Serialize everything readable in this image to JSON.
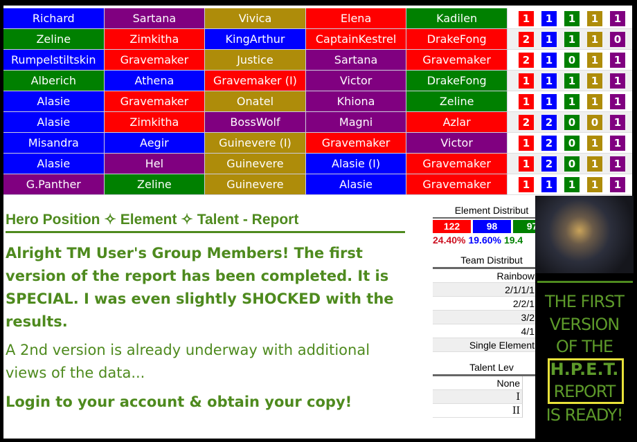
{
  "colors": {
    "red": "#ff0000",
    "blue": "#0000ff",
    "green": "#008000",
    "gold": "#ae8c0a",
    "purple": "#800080",
    "accent": "#4e8a1e"
  },
  "teams": [
    {
      "heroes": [
        [
          "Richard",
          "blue"
        ],
        [
          "Sartana",
          "purple"
        ],
        [
          "Vivica",
          "gold"
        ],
        [
          "Elena",
          "red"
        ],
        [
          "Kadilen",
          "green"
        ]
      ],
      "counts": [
        1,
        1,
        1,
        1,
        1
      ]
    },
    {
      "heroes": [
        [
          "Zeline",
          "green"
        ],
        [
          "Zimkitha",
          "red"
        ],
        [
          "KingArthur",
          "blue"
        ],
        [
          "CaptainKestrel",
          "red"
        ],
        [
          "DrakeFong",
          "red"
        ]
      ],
      "counts": [
        2,
        1,
        1,
        1,
        0
      ]
    },
    {
      "heroes": [
        [
          "Rumpelstiltskin",
          "blue"
        ],
        [
          "Gravemaker",
          "red"
        ],
        [
          "Justice",
          "gold"
        ],
        [
          "Sartana",
          "purple"
        ],
        [
          "Gravemaker",
          "red"
        ]
      ],
      "counts": [
        2,
        1,
        0,
        1,
        1
      ]
    },
    {
      "heroes": [
        [
          "Alberich",
          "green"
        ],
        [
          "Athena",
          "blue"
        ],
        [
          "Gravemaker (I)",
          "red"
        ],
        [
          "Victor",
          "purple"
        ],
        [
          "DrakeFong",
          "green"
        ]
      ],
      "counts": [
        1,
        1,
        1,
        1,
        1
      ]
    },
    {
      "heroes": [
        [
          "Alasie",
          "blue"
        ],
        [
          "Gravemaker",
          "red"
        ],
        [
          "Onatel",
          "gold"
        ],
        [
          "Khiona",
          "purple"
        ],
        [
          "Zeline",
          "green"
        ]
      ],
      "counts": [
        1,
        1,
        1,
        1,
        1
      ]
    },
    {
      "heroes": [
        [
          "Alasie",
          "blue"
        ],
        [
          "Zimkitha",
          "red"
        ],
        [
          "BossWolf",
          "purple"
        ],
        [
          "Magni",
          "purple"
        ],
        [
          "Azlar",
          "red"
        ]
      ],
      "counts": [
        2,
        2,
        0,
        0,
        1
      ]
    },
    {
      "heroes": [
        [
          "Misandra",
          "blue"
        ],
        [
          "Aegir",
          "blue"
        ],
        [
          "Guinevere (I)",
          "gold"
        ],
        [
          "Gravemaker",
          "red"
        ],
        [
          "Victor",
          "purple"
        ]
      ],
      "counts": [
        1,
        2,
        0,
        1,
        1
      ]
    },
    {
      "heroes": [
        [
          "Alasie",
          "blue"
        ],
        [
          "Hel",
          "purple"
        ],
        [
          "Guinevere",
          "gold"
        ],
        [
          "Alasie (I)",
          "blue"
        ],
        [
          "Gravemaker",
          "red"
        ]
      ],
      "counts": [
        1,
        2,
        0,
        1,
        1
      ]
    },
    {
      "heroes": [
        [
          "G.Panther",
          "purple"
        ],
        [
          "Zeline",
          "green"
        ],
        [
          "Guinevere",
          "gold"
        ],
        [
          "Alasie",
          "blue"
        ],
        [
          "Gravemaker",
          "red"
        ]
      ],
      "counts": [
        1,
        1,
        1,
        1,
        1
      ]
    }
  ],
  "count_colors": [
    "red",
    "blue",
    "green",
    "gold",
    "purple"
  ],
  "report": {
    "title": "Hero Position ✧ Element ✧ Talent - Report",
    "p1": "Alright TM User's Group Members!  The first version of the report has been completed.   It is SPECIAL.  I was even slightly SHOCKED with the results.",
    "p2": "A 2nd version is already underway with additional views of the data...",
    "p3": "Login to your account & obtain your copy!"
  },
  "side": {
    "element_heading": "Element Distribut",
    "elements": [
      {
        "count": "122",
        "pct": "24.40%",
        "color": "red"
      },
      {
        "count": "98",
        "pct": "19.60%",
        "color": "blue"
      },
      {
        "count": "97",
        "pct": "19.4",
        "color": "green"
      }
    ],
    "team_heading": "Team Distribut",
    "team_rows": [
      "Rainbow",
      "2/1/1/1",
      "2/2/1",
      "3/2",
      "4/1",
      "Single Element"
    ],
    "talent_heading": "Talent Lev",
    "talent_rows": [
      "None",
      "I",
      "II"
    ]
  },
  "promo": {
    "line1": "THE FIRST",
    "line2": "VERSION",
    "line3": "OF THE",
    "line4": "H.P.E.T.",
    "line5": "REPORT",
    "line6": "IS READY!"
  }
}
